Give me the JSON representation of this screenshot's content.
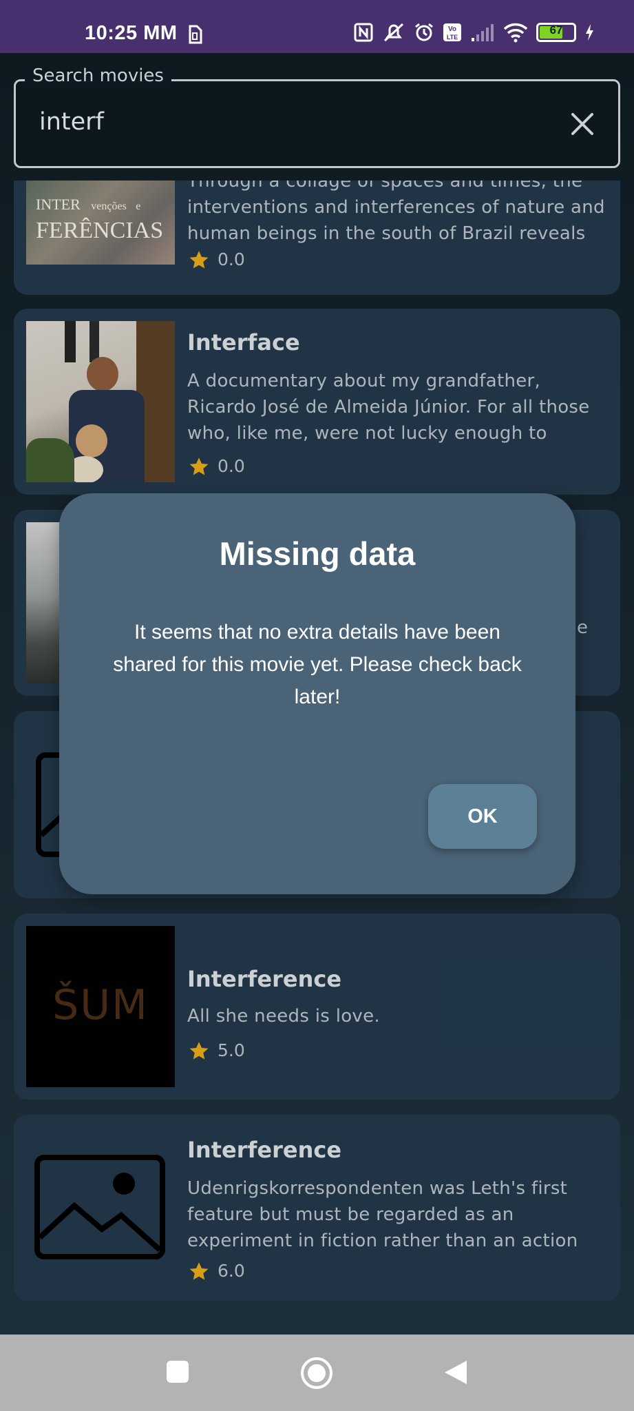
{
  "status_bar": {
    "time": "10:25 MM",
    "battery_level": "67",
    "icons": [
      "sim-icon",
      "nfc-icon",
      "silent-icon",
      "alarm-icon",
      "volte-icon",
      "signal-icon",
      "wifi-icon",
      "battery-icon",
      "charging-icon"
    ]
  },
  "search": {
    "label": "Search movies",
    "value": "interf",
    "clear_icon": "close-icon"
  },
  "movies": [
    {
      "poster_text_line1": "INTER",
      "poster_text_line1b": "venções",
      "poster_text_line1c": "e",
      "poster_text_line2": "FERÊNCIAS",
      "description": "Through a collage of spaces and times, the interventions and interferences of nature and human beings in the south of Brazil reveals",
      "rating": "0.0"
    },
    {
      "title": "Interface",
      "description": "A documentary about my grandfather, Ricardo José de Almeida Júnior.  For all those who, like me, were not lucky enough to",
      "rating": "0.0"
    },
    {
      "partial_text": "e"
    },
    {
      "poster": "image-placeholder-icon"
    },
    {
      "poster_text": "ŠUM",
      "title": "Interference",
      "description": "All she needs is love.",
      "rating": "5.0"
    },
    {
      "poster": "image-placeholder-icon",
      "title": "Interference",
      "description": "Udenrigskorrespondenten was Leth's first feature but must be regarded as an experiment in fiction rather than an action",
      "rating": "6.0"
    }
  ],
  "dialog": {
    "title": "Missing data",
    "message": "It seems that no extra details have been shared for this movie yet. Please check back later!",
    "ok_label": "OK"
  },
  "colors": {
    "status_bar": "#48306f",
    "card": "#22384a",
    "dialog": "#4a6377",
    "ok_button": "#5c8096",
    "star": "#e6a817"
  },
  "nav_bar": {
    "items": [
      "recents-icon",
      "home-icon",
      "back-icon"
    ]
  }
}
